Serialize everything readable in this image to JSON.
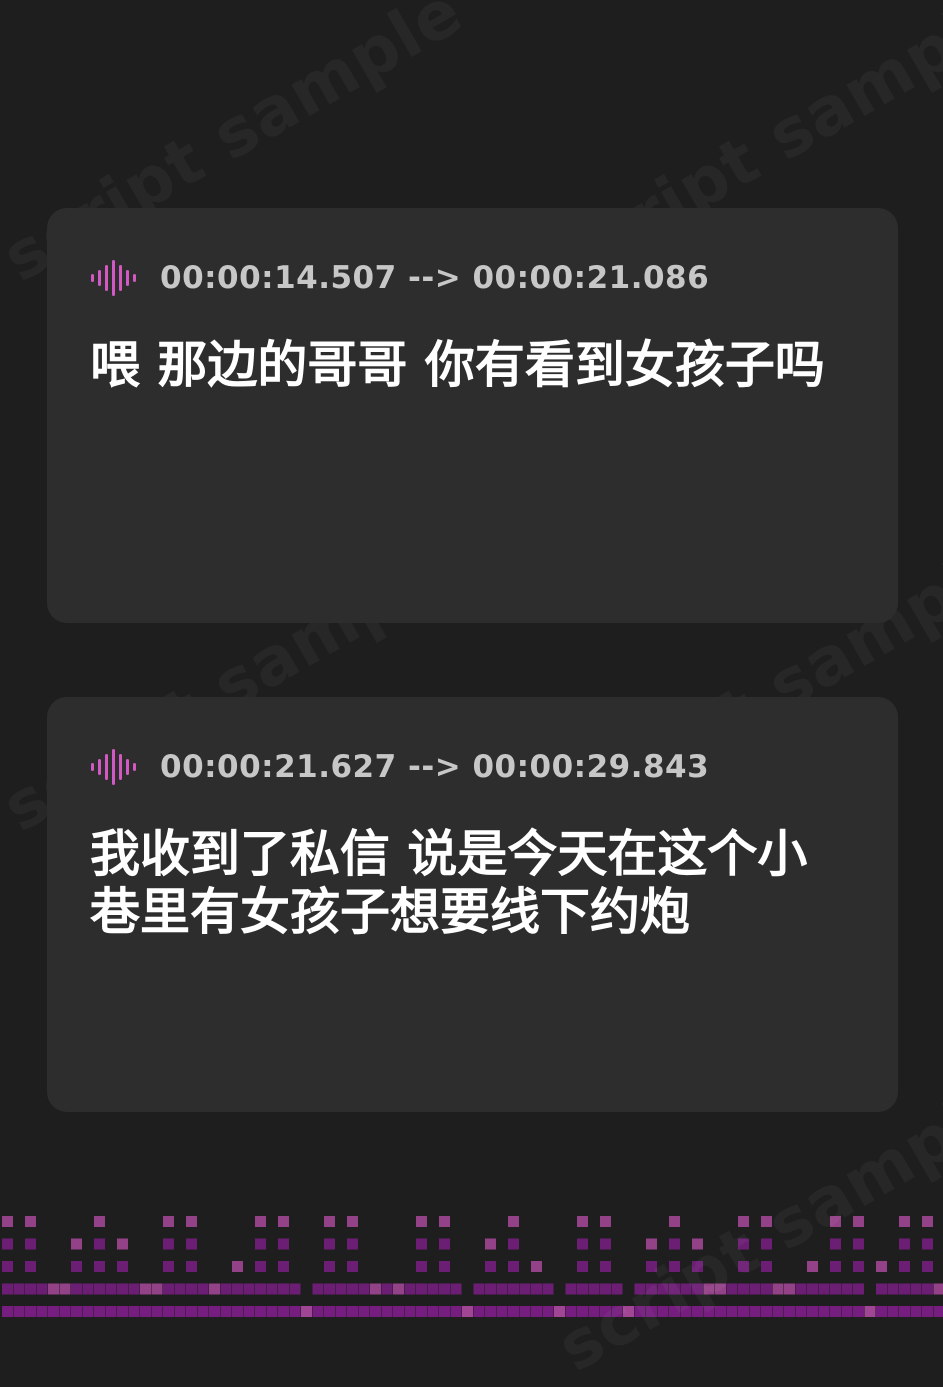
{
  "watermark": "script sample",
  "accent_colors": {
    "icon_gradient_start": "#c35be0",
    "icon_gradient_end": "#e157a6",
    "equalizer_dark": "#7a1f85",
    "equalizer_light": "#a9499b"
  },
  "cards": [
    {
      "icon": "sound-wave-icon",
      "timestamp": "00:00:14.507 --> 00:00:21.086",
      "text": "喂 那边的哥哥 你有看到女孩子吗"
    },
    {
      "icon": "sound-wave-icon",
      "timestamp": "00:00:21.627 --> 00:00:29.843",
      "text": "我收到了私信 说是今天在这个小巷里有女孩子想要线下约炮"
    }
  ]
}
